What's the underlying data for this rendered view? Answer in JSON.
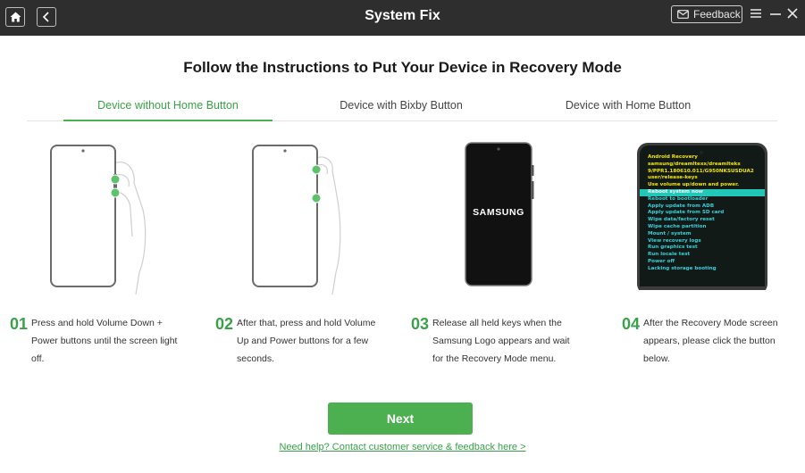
{
  "titlebar": {
    "title": "System Fix",
    "feedback_label": "Feedback",
    "icons": [
      "home-icon",
      "back-icon",
      "mail-icon",
      "menu-icon",
      "minimize-icon",
      "close-icon"
    ]
  },
  "heading": "Follow the Instructions to Put Your Device in Recovery Mode",
  "tabs": [
    {
      "label": "Device without Home Button",
      "active": true
    },
    {
      "label": "Device with Bixby Button",
      "active": false
    },
    {
      "label": "Device with Home Button",
      "active": false
    }
  ],
  "phone_logo": "SAMSUNG",
  "recovery_screen": {
    "header_lines": [
      "Android Recovery",
      "samsung/dreamltexx/dreamlteks",
      "9/PPR1.180610.011/G950NKSUSDUA2",
      "user/release-keys",
      "Use volume up/down and power."
    ],
    "menu_items": [
      "Reboot system now",
      "Reboot to bootloader",
      "Apply update from ADB",
      "Apply update from SD card",
      "Wipe data/factory reset",
      "Wipe cache partition",
      "Mount / system",
      "View recovery logs",
      "Run graphics test",
      "Run locale test",
      "Power off",
      "Lacking storage booting"
    ],
    "selected_index": 0
  },
  "steps": [
    {
      "num": "01",
      "lines": [
        "Press and hold Volume Down +",
        "Power buttons until the screen light",
        "off."
      ]
    },
    {
      "num": "02",
      "lines": [
        "After that, press and hold Volume",
        "Up and Power buttons for a few",
        "seconds."
      ]
    },
    {
      "num": "03",
      "lines": [
        "Release all held keys when the",
        "Samsung Logo appears and wait",
        "for the Recovery Mode menu."
      ]
    },
    {
      "num": "04",
      "lines": [
        "After the Recovery Mode screen",
        "appears, please click the button",
        "below."
      ]
    }
  ],
  "next_label": "Next",
  "help_link": "Need help? Contact customer service & feedback here >",
  "colors": {
    "accent": "#4caf50",
    "titlebar": "#2e2e2e",
    "recovery_highlight": "#22c7b8"
  }
}
